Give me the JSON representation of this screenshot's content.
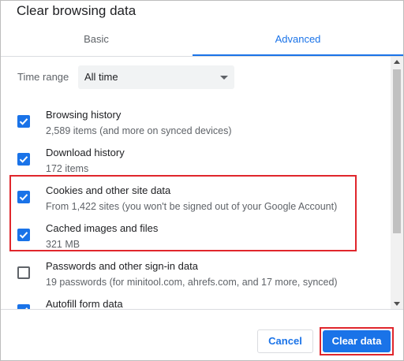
{
  "dialog": {
    "title": "Clear browsing data"
  },
  "tabs": [
    {
      "label": "Basic",
      "active": false
    },
    {
      "label": "Advanced",
      "active": true
    }
  ],
  "time_range": {
    "label": "Time range",
    "selected": "All time"
  },
  "items": [
    {
      "title": "Browsing history",
      "description": "2,589 items (and more on synced devices)",
      "checked": true
    },
    {
      "title": "Download history",
      "description": "172 items",
      "checked": true
    },
    {
      "title": "Cookies and other site data",
      "description": "From 1,422 sites (you won't be signed out of your Google Account)",
      "checked": true
    },
    {
      "title": "Cached images and files",
      "description": "321 MB",
      "checked": true
    },
    {
      "title": "Passwords and other sign-in data",
      "description": "19 passwords (for minitool.com, ahrefs.com, and 17 more, synced)",
      "checked": false
    },
    {
      "title": "Autofill form data",
      "description": "",
      "checked": true
    }
  ],
  "buttons": {
    "cancel": "Cancel",
    "clear": "Clear data"
  },
  "colors": {
    "accent": "#1a73e8",
    "highlight": "#e0262c"
  }
}
